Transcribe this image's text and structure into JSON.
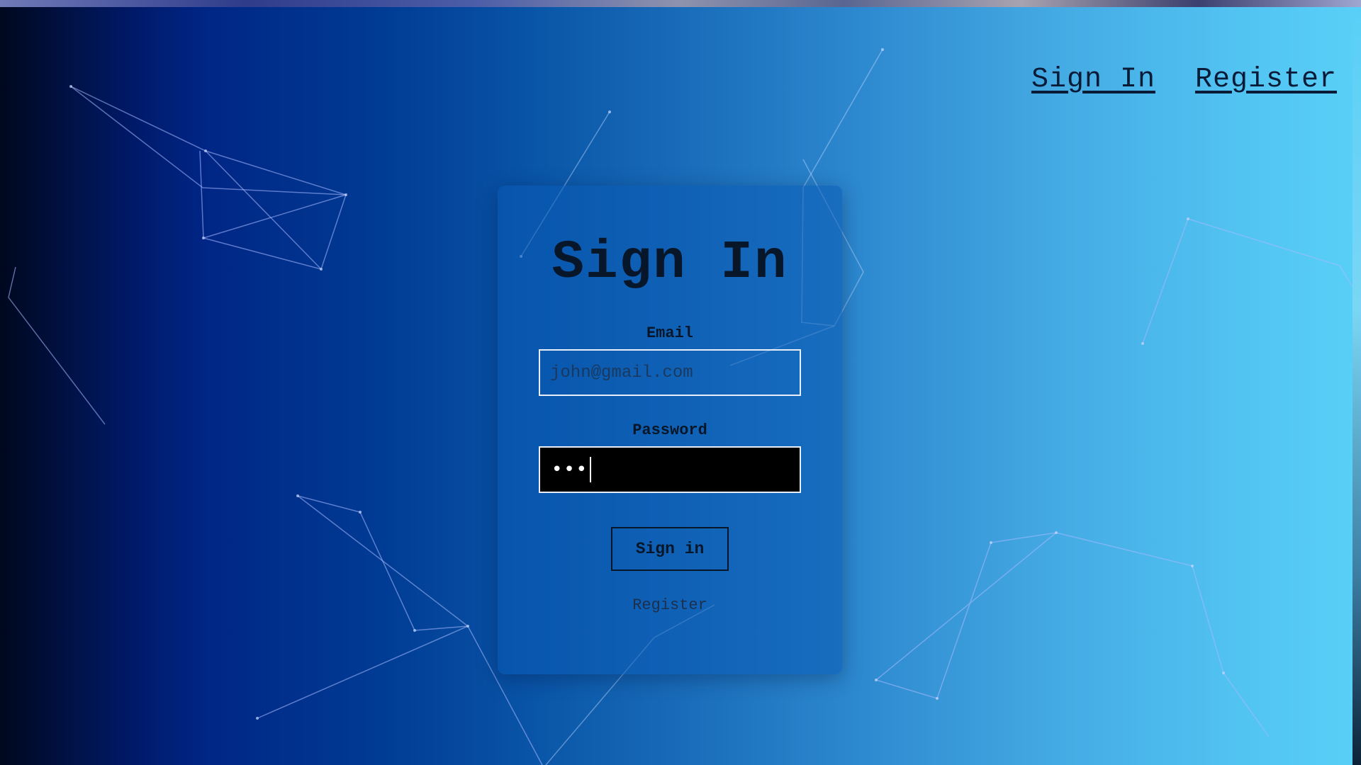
{
  "nav": {
    "sign_in": "Sign In",
    "register": "Register"
  },
  "form": {
    "title": "Sign In",
    "email_label": "Email",
    "email_placeholder": "john@gmail.com",
    "password_label": "Password",
    "password_value": "•••",
    "submit_label": "Sign in",
    "register_link": "Register"
  },
  "colors": {
    "gradient_start": "#00081f",
    "gradient_mid": "#0a56a8",
    "gradient_end": "#58cff7",
    "text_dark": "#071628",
    "password_bg": "#000000"
  }
}
